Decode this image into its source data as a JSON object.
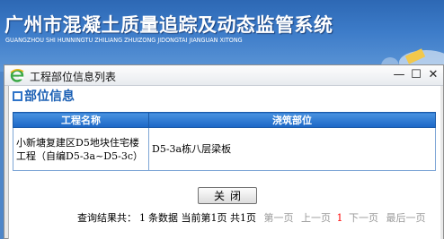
{
  "app": {
    "title": "广州市混凝土质量追踪及动态监管系统",
    "subtitle_pinyin": "GUANGZHOU SHI HUNNINGTU ZHILIANG ZHUIZONG JIDONGTAI JIANGUAN XITONG"
  },
  "dialog": {
    "title": "工程部位信息列表",
    "window_buttons": {
      "minimize": "—",
      "maximize": "☐",
      "close": "✕"
    },
    "section_title": "部位信息",
    "table": {
      "headers": [
        "工程名称",
        "浇筑部位"
      ],
      "rows": [
        [
          "小新塘复建区D5地块住宅楼工程（自编D5-3a~D5-3c）",
          "D5-3a栋八层梁板"
        ]
      ]
    },
    "close_button": "关闭",
    "pager": {
      "prefix": "查询结果共：",
      "total": "1",
      "total_unit": "条数据",
      "current_prefix": "当前第",
      "current_page": "1",
      "current_suffix": "页",
      "pages_prefix": "共",
      "pages": "1",
      "pages_suffix": "页",
      "first": "第一页",
      "prev": "上一页",
      "page_link": "1",
      "next": "下一页",
      "last": "最后一页"
    }
  }
}
